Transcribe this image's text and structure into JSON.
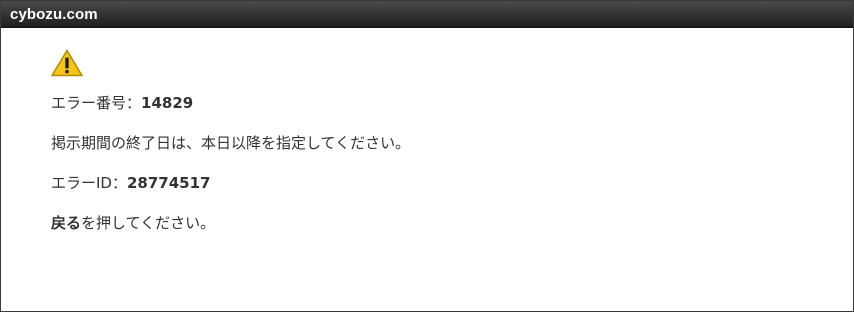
{
  "header": {
    "brand": "cybozu.com"
  },
  "error": {
    "icon": "warning-icon",
    "number_label": "エラー番号：",
    "number_value": "14829",
    "message": "掲示期間の終了日は、本日以降を指定してください。",
    "id_label": "エラーID：",
    "id_value": "28774517",
    "back_link": "戻る",
    "back_suffix": "を押してください。"
  },
  "colors": {
    "header_bg": "#2b2b2b",
    "warning_fill": "#f5c518",
    "warning_stroke": "#b58a00",
    "text": "#333333"
  }
}
